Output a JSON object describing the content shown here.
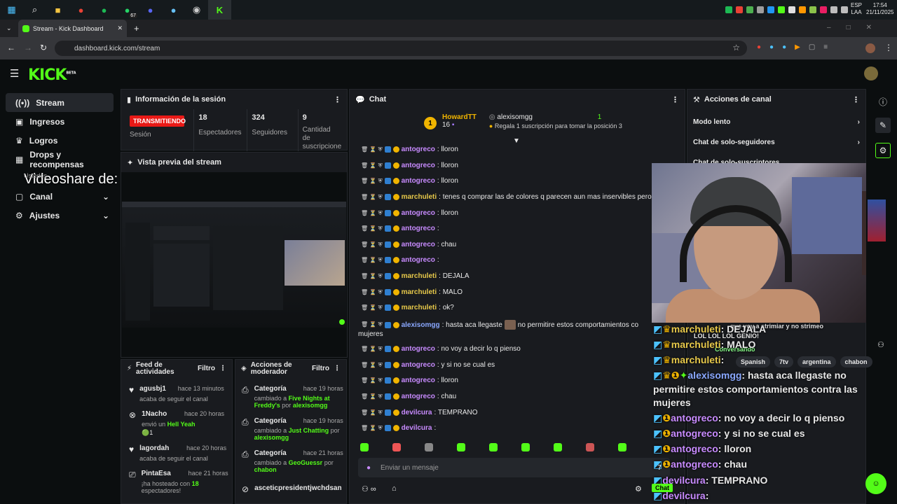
{
  "taskbar": {
    "badge_count": "67",
    "lang": "ESP",
    "lang2": "LAA",
    "time": "17:54",
    "date": "21/11/2025"
  },
  "browser": {
    "tab_title": "Stream - Kick Dashboard",
    "url": "dashboard.kick.com/stream"
  },
  "header": {
    "logo": "KICK",
    "beta": "BETA"
  },
  "sidebar": {
    "items": [
      {
        "label": "Stream",
        "icon": "stream-icon"
      },
      {
        "label": "Ingresos",
        "icon": "money-icon"
      },
      {
        "label": "Logros",
        "icon": "trophy-icon"
      },
      {
        "label": "Drops y recompensas",
        "icon": "gift-icon"
      },
      {
        "label": "Canal",
        "icon": "channel-icon"
      },
      {
        "label": "Ajustes",
        "icon": "gear-icon"
      }
    ],
    "overlay_text": "Videoshare de:",
    "overlay_small": "Ustedes"
  },
  "session": {
    "title": "Información de la sesión",
    "live_label": "TRANSMITIENDO",
    "session_label": "Sesión",
    "stats": [
      {
        "value": "18",
        "label": "Espectadores"
      },
      {
        "value": "324",
        "label": "Seguidores"
      },
      {
        "value": "9",
        "label": "Cantidad de suscripcione"
      }
    ]
  },
  "preview": {
    "title": "Vista previa del stream"
  },
  "feed": {
    "title": "Feed de actividades",
    "filter": "Filtro",
    "items": [
      {
        "user": "agusbj1",
        "time": "hace 13 minutos",
        "text": "acaba de seguir el canal"
      },
      {
        "user": "1Nacho",
        "time": "hace 20 horas",
        "text": "envió un ",
        "highlight": "Hell Yeah",
        "extra": "1"
      },
      {
        "user": "lagordah",
        "time": "hace 20 horas",
        "text": "acaba de seguir el canal"
      },
      {
        "user": "PintaEsa",
        "time": "hace 21 horas",
        "text": "¡ha hosteado con ",
        "highlight": "18",
        "text2": "espectadores!"
      }
    ]
  },
  "modactions": {
    "title": "Acciones de moderador",
    "filter": "Filtro",
    "items": [
      {
        "title": "Categoría",
        "time": "hace 19 horas",
        "pre": "cambiado a ",
        "category": "Five Nights at Freddy's",
        "by": "por",
        "mod": "alexisomgg"
      },
      {
        "title": "Categoría",
        "time": "hace 19 horas",
        "pre": "cambiado a ",
        "category": "Just Chatting",
        "by": "por",
        "mod": "alexisomgg"
      },
      {
        "title": "Categoría",
        "time": "hace 21 horas",
        "pre": "cambiado a ",
        "category": "GeoGuessr",
        "by": "por",
        "mod": "chabon"
      },
      {
        "title": "asceticpresidentjwchdsan",
        "time": "",
        "pre": "",
        "category": "",
        "by": "",
        "mod": ""
      }
    ]
  },
  "chat": {
    "title": "Chat",
    "pinned_user": "HowardTT",
    "pinned_rank": "1",
    "pinned_count": "16",
    "gift_user": "alexisomgg",
    "gift_count": "1",
    "gift_text": "Regala 1 suscripción para tomar la posición 3",
    "input_placeholder": "Enviar un mensaje",
    "messages": [
      {
        "user": "antogreco",
        "text": ": lloron",
        "color": "#c88bff"
      },
      {
        "user": "antogreco",
        "text": ": lloron",
        "color": "#c88bff"
      },
      {
        "user": "antogreco",
        "text": ": lloron",
        "color": "#c88bff"
      },
      {
        "user": "marchuleti",
        "text": ": tenes q comprar las de colores q parecen aun mas inservibles pero sal",
        "color": "#e6c84a"
      },
      {
        "user": "antogreco",
        "text": ": lloron",
        "color": "#c88bff"
      },
      {
        "user": "antogreco",
        "text": ":",
        "color": "#c88bff"
      },
      {
        "user": "antogreco",
        "text": ": chau",
        "color": "#c88bff"
      },
      {
        "user": "antogreco",
        "text": ":",
        "color": "#c88bff"
      },
      {
        "user": "marchuleti",
        "text": ": DEJALA",
        "color": "#e6c84a"
      },
      {
        "user": "marchuleti",
        "text": ": MALO",
        "color": "#e6c84a"
      },
      {
        "user": "marchuleti",
        "text": ": ok?",
        "color": "#e6c84a"
      },
      {
        "user": "alexisomgg",
        "text": ": hasta aca llegaste",
        "text2": " no permitire estos comportamientos co",
        "color": "#8aa8ff"
      },
      {
        "user": "antogreco",
        "text": ": no voy a decir lo q pienso",
        "color": "#c88bff"
      },
      {
        "user": "antogreco",
        "text": ": y si no se cual es",
        "color": "#c88bff"
      },
      {
        "user": "antogreco",
        "text": ": lloron",
        "color": "#c88bff"
      },
      {
        "user": "antogreco",
        "text": ": chau",
        "color": "#c88bff"
      },
      {
        "user": "devilcura",
        "text": ": TEMPRANO",
        "color": "#c88bff"
      },
      {
        "user": "devilcura",
        "text": ":",
        "color": "#c88bff"
      }
    ],
    "wrap_text": "mujeres"
  },
  "actions": {
    "title": "Acciones de canal",
    "items": [
      "Modo lento",
      "Chat de solo-seguidores",
      "Chat de solo-suscriptores"
    ]
  },
  "overlay": {
    "line1_user": "marchuleti",
    "line1_text": ": DEJALA",
    "behind": "que voy a strimiar y no strimeo",
    "lol": "LOL LOL LOL GENIO!",
    "conversando": "Conversando",
    "line2_user": "marchuleti",
    "line2_text": ": MALO",
    "line3_user": "marchuleti",
    "line3_text": ":",
    "line4_user": "alexisomgg",
    "line4_text": ": hasta aca llegaste",
    "line4_cont": " no",
    "line5": "permitire estos comportamientos contra las",
    "line6": "mujeres",
    "line7_user": "antogreco",
    "line7_text": ": no voy a decir lo q pienso",
    "line8_user": "antogreco",
    "line8_text": ": y si no se cual es",
    "line9_user": "antogreco",
    "line9_text": ": lloron",
    "line10_user": "antogreco",
    "line10_text": ": chau",
    "line11_user": "devilcura",
    "line11_text": ": TEMPRANO",
    "line12_user": "devilcura",
    "line12_text": ":",
    "chat_tag": "Chat",
    "tags": [
      "Spanish",
      "7tv",
      "argentina",
      "chabon"
    ]
  },
  "colors": {
    "kick_green": "#53fc18",
    "live_red": "#e91916",
    "gold": "#f0b400"
  }
}
